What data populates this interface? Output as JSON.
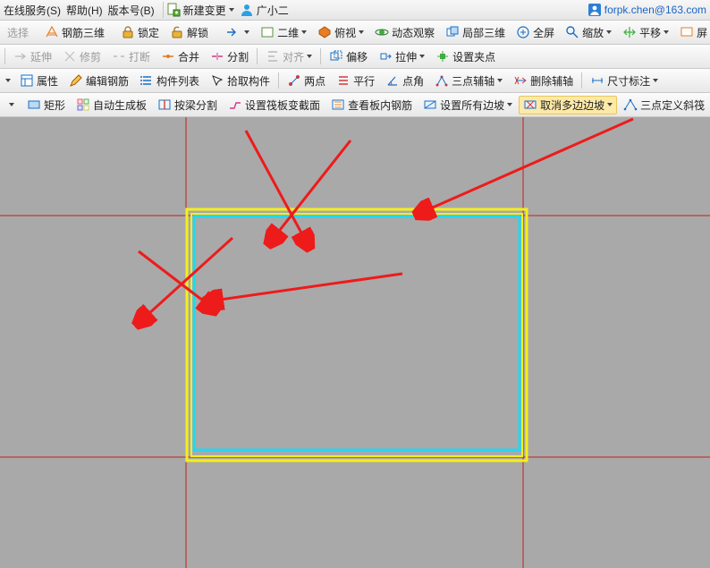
{
  "menubar": {
    "online_service": "在线服务(S)",
    "help": "帮助(H)",
    "version": "版本号(B)",
    "new_change": "新建变更",
    "guang_xiao_er": "广小二",
    "user": "forpk.chen@163.com"
  },
  "tb1": {
    "select": "选择",
    "rebar_3d": "钢筋三维",
    "lock": "锁定",
    "unlock": "解锁",
    "two_d": "二维",
    "top_view": "俯视",
    "dynamic_observe": "动态观察",
    "local_3d": "局部三维",
    "fullscreen": "全屏",
    "zoom": "缩放",
    "pan": "平移",
    "screen": "屏"
  },
  "tb2": {
    "extend": "延伸",
    "trim": "修剪",
    "break": "打断",
    "join": "合并",
    "split": "分割",
    "align": "对齐",
    "offset": "偏移",
    "stretch": "拉伸",
    "set_clamp": "设置夹点"
  },
  "tb3": {
    "properties": "属性",
    "edit_rebar": "编辑钢筋",
    "component_list": "构件列表",
    "pick_component": "拾取构件",
    "two_point": "两点",
    "parallel": "平行",
    "point_angle": "点角",
    "three_point_aux": "三点辅轴",
    "delete_aux": "删除辅轴",
    "dimension": "尺寸标注"
  },
  "tb4": {
    "rectangle": "矩形",
    "auto_gen_slab": "自动生成板",
    "split_by_beam": "按梁分割",
    "set_raft_section": "设置筏板变截面",
    "view_rebar_in_slab": "查看板内钢筋",
    "set_all_slopes": "设置所有边坡",
    "cancel_multi_slope": "取消多边边坡",
    "three_point_slope": "三点定义斜筏"
  }
}
